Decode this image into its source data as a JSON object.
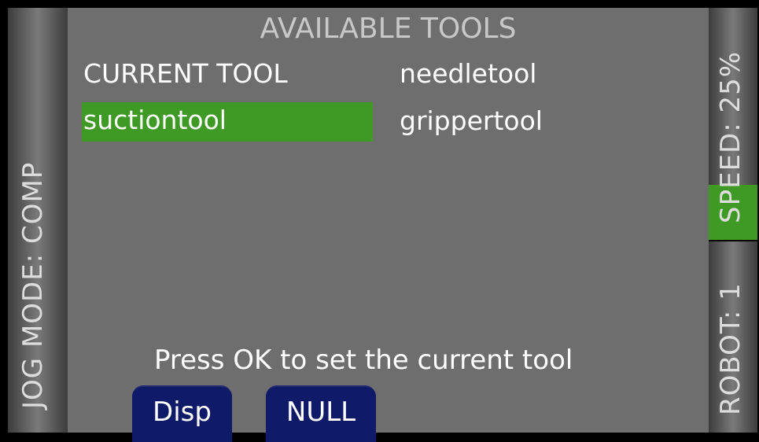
{
  "left_bar": {
    "label": "JOG MODE: COMP"
  },
  "right_bar": {
    "speed_label": "SPEED: 25%",
    "robot_label": "ROBOT: 1"
  },
  "main": {
    "title": "AVAILABLE TOOLS",
    "current_tool_label": "CURRENT TOOL",
    "tools": [
      "needletool",
      "suctiontool",
      "grippertool"
    ],
    "hint": "Press OK to set the current tool"
  },
  "buttons": {
    "disp": "Disp",
    "null": "NULL"
  },
  "colors": {
    "highlight": "#3f9a25",
    "button": "#0f1a68",
    "panel": "#6e6e6e"
  }
}
